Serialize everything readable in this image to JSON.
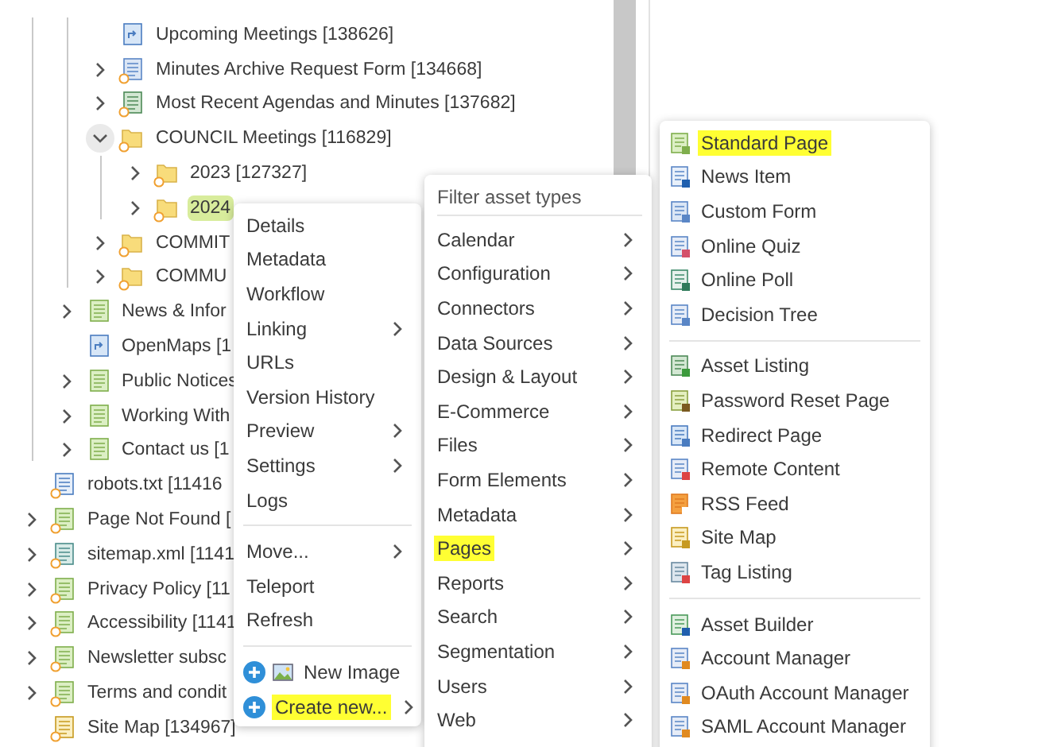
{
  "tree": {
    "items": [
      {
        "children": [
          {
            "children": [
              {
                "label": "Upcoming Meetings [138626]",
                "kind": "redirect",
                "badge": false,
                "expandable": false,
                "selected": false
              },
              {
                "label": "Minutes Archive Request Form [134668]",
                "kind": "form",
                "badge": true,
                "expandable": true,
                "expanded": false,
                "selected": false
              },
              {
                "label": "Most Recent Agendas and Minutes [137682]",
                "kind": "listing",
                "badge": true,
                "expandable": true,
                "expanded": false,
                "selected": false
              },
              {
                "label": "COUNCIL Meetings [116829]",
                "kind": "folder",
                "badge": true,
                "expandable": true,
                "expanded": true,
                "selected": false,
                "children": [
                  {
                    "label": "2023 [127327]",
                    "kind": "folder",
                    "badge": true,
                    "expandable": true,
                    "expanded": false,
                    "selected": false
                  },
                  {
                    "label": "2024",
                    "kind": "folder",
                    "badge": true,
                    "expandable": true,
                    "expanded": false,
                    "selected": true
                  }
                ]
              },
              {
                "label": "COMMIT",
                "kind": "folder",
                "badge": true,
                "expandable": true,
                "expanded": false,
                "selected": false
              },
              {
                "label": "COMMU",
                "kind": "folder",
                "badge": true,
                "expandable": true,
                "expanded": false,
                "selected": false
              }
            ]
          },
          {
            "label": "News & Infor",
            "kind": "page",
            "badge": false,
            "expandable": true,
            "expanded": false,
            "selected": false
          },
          {
            "label": "OpenMaps [1",
            "kind": "redirect",
            "badge": false,
            "expandable": false,
            "selected": false
          },
          {
            "label": "Public Notices",
            "kind": "page",
            "badge": false,
            "expandable": true,
            "expanded": false,
            "selected": false
          },
          {
            "label": "Working With",
            "kind": "page",
            "badge": false,
            "expandable": true,
            "expanded": false,
            "selected": false
          },
          {
            "label": "Contact us [1",
            "kind": "page",
            "badge": false,
            "expandable": true,
            "expanded": false,
            "selected": false
          }
        ]
      },
      {
        "label": "robots.txt [11416",
        "kind": "text-file",
        "badge": true,
        "expandable": false,
        "selected": false
      },
      {
        "label": "Page Not Found [",
        "kind": "page",
        "badge": true,
        "expandable": true,
        "expanded": false,
        "selected": false
      },
      {
        "label": "sitemap.xml [1141",
        "kind": "xml",
        "badge": true,
        "expandable": true,
        "expanded": false,
        "selected": false
      },
      {
        "label": "Privacy Policy [11",
        "kind": "page",
        "badge": true,
        "expandable": true,
        "expanded": false,
        "selected": false
      },
      {
        "label": "Accessibility [1141",
        "kind": "page",
        "badge": true,
        "expandable": true,
        "expanded": false,
        "selected": false
      },
      {
        "label": "Newsletter subsc",
        "kind": "page",
        "badge": true,
        "expandable": true,
        "expanded": false,
        "selected": false
      },
      {
        "label": "Terms and condit",
        "kind": "page",
        "badge": true,
        "expandable": true,
        "expanded": false,
        "selected": false
      },
      {
        "label": "Site Map [134967]",
        "kind": "sitemap",
        "badge": true,
        "expandable": false,
        "selected": false
      }
    ]
  },
  "context_menu": {
    "groups": [
      [
        {
          "label": "Details",
          "submenu": false,
          "highlighted": false
        },
        {
          "label": "Metadata",
          "submenu": false,
          "highlighted": false
        },
        {
          "label": "Workflow",
          "submenu": false,
          "highlighted": false
        },
        {
          "label": "Linking",
          "submenu": true,
          "highlighted": false
        },
        {
          "label": "URLs",
          "submenu": false,
          "highlighted": false
        },
        {
          "label": "Version History",
          "submenu": false,
          "highlighted": false
        },
        {
          "label": "Preview",
          "submenu": true,
          "highlighted": false
        },
        {
          "label": "Settings",
          "submenu": true,
          "highlighted": false
        },
        {
          "label": "Logs",
          "submenu": false,
          "highlighted": false
        }
      ],
      [
        {
          "label": "Move...",
          "submenu": true,
          "highlighted": false
        },
        {
          "label": "Teleport",
          "submenu": false,
          "highlighted": false
        },
        {
          "label": "Refresh",
          "submenu": false,
          "highlighted": false
        }
      ],
      [
        {
          "label": "New Image",
          "kind": "image",
          "submenu": false,
          "highlighted": false
        },
        {
          "label": "Create new...",
          "kind": "create",
          "submenu": true,
          "highlighted": true
        }
      ]
    ]
  },
  "asset_types_menu": {
    "filter": {
      "placeholder": "Filter asset types"
    },
    "items": [
      {
        "label": "Calendar",
        "highlighted": false
      },
      {
        "label": "Configuration",
        "highlighted": false
      },
      {
        "label": "Connectors",
        "highlighted": false
      },
      {
        "label": "Data Sources",
        "highlighted": false
      },
      {
        "label": "Design & Layout",
        "highlighted": false
      },
      {
        "label": "E-Commerce",
        "highlighted": false
      },
      {
        "label": "Files",
        "highlighted": false
      },
      {
        "label": "Form Elements",
        "highlighted": false
      },
      {
        "label": "Metadata",
        "highlighted": false
      },
      {
        "label": "Pages",
        "highlighted": true
      },
      {
        "label": "Reports",
        "highlighted": false
      },
      {
        "label": "Search",
        "highlighted": false
      },
      {
        "label": "Segmentation",
        "highlighted": false
      },
      {
        "label": "Users",
        "highlighted": false
      },
      {
        "label": "Web",
        "highlighted": false
      }
    ]
  },
  "pages_menu": {
    "groups": [
      [
        {
          "label": "Standard Page",
          "kind": "page",
          "highlighted": true
        },
        {
          "label": "News Item",
          "kind": "news",
          "highlighted": false
        },
        {
          "label": "Custom Form",
          "kind": "form",
          "highlighted": false
        },
        {
          "label": "Online Quiz",
          "kind": "quiz",
          "highlighted": false
        },
        {
          "label": "Online Poll",
          "kind": "poll",
          "highlighted": false
        },
        {
          "label": "Decision Tree",
          "kind": "tree",
          "highlighted": false
        }
      ],
      [
        {
          "label": "Asset Listing",
          "kind": "listing",
          "highlighted": false
        },
        {
          "label": "Password Reset Page",
          "kind": "key",
          "highlighted": false
        },
        {
          "label": "Redirect Page",
          "kind": "redirect",
          "highlighted": false
        },
        {
          "label": "Remote Content",
          "kind": "remote",
          "highlighted": false
        },
        {
          "label": "RSS Feed",
          "kind": "rss",
          "highlighted": false
        },
        {
          "label": "Site Map",
          "kind": "sitemap",
          "highlighted": false
        },
        {
          "label": "Tag Listing",
          "kind": "tag",
          "highlighted": false
        }
      ],
      [
        {
          "label": "Asset Builder",
          "kind": "builder",
          "highlighted": false
        },
        {
          "label": "Account Manager",
          "kind": "account",
          "highlighted": false
        },
        {
          "label": "OAuth Account Manager",
          "kind": "account",
          "highlighted": false
        },
        {
          "label": "SAML Account Manager",
          "kind": "account",
          "highlighted": false
        }
      ]
    ]
  }
}
